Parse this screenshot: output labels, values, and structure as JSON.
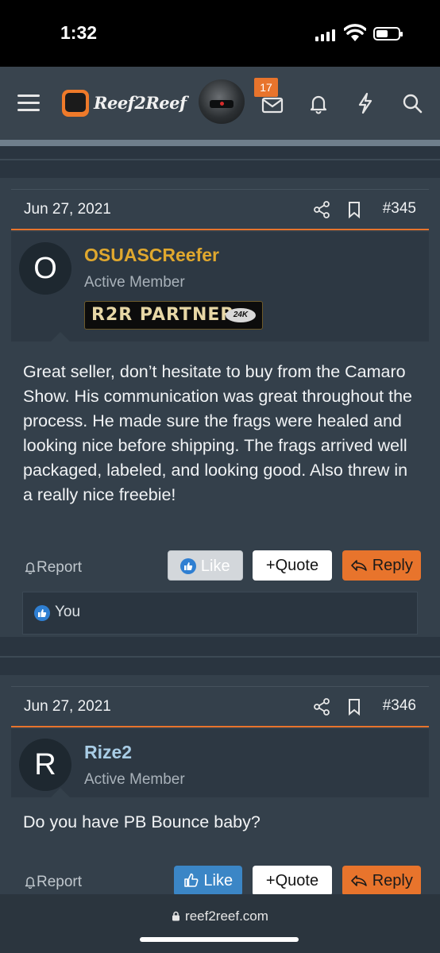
{
  "status_bar": {
    "time": "1:32",
    "battery_level": 0.55
  },
  "header": {
    "logo_text": "Reef2Reef",
    "notification_count": "17",
    "icons": [
      "menu-icon",
      "mail-icon",
      "bell-icon",
      "lightning-icon",
      "search-icon"
    ]
  },
  "posts": [
    {
      "date": "Jun 27, 2021",
      "number": "#345",
      "avatar_letter": "O",
      "username": "OSUASCReefer",
      "username_color": "#e0a82e",
      "user_title": "Active Member",
      "partner_badge": "R2R PARTNER",
      "partner_badge_level": "24K",
      "body": "Great seller, don’t hesitate to buy from the Camaro Show. His communication was great throughout the process. He made sure the frags were healed and looking nice before shipping. The frags arrived well packaged, labeled, and looking good. Also threw in a really nice freebie!",
      "actions": {
        "report": "Report",
        "like": "Like",
        "quote": "Quote",
        "reply": "Reply"
      },
      "liked_by": "You"
    },
    {
      "date": "Jun 27, 2021",
      "number": "#346",
      "avatar_letter": "R",
      "username": "Rize2",
      "username_color": "#a9cde6",
      "user_title": "Active Member",
      "body": "Do you have PB Bounce baby?",
      "actions": {
        "report": "Report",
        "like": "Like",
        "quote": "Quote",
        "reply": "Reply"
      }
    }
  ],
  "browser": {
    "url": "reef2reef.com"
  },
  "colors": {
    "accent": "#e8742c",
    "like_blue": "#3b86c6",
    "panel": "#34404b"
  }
}
